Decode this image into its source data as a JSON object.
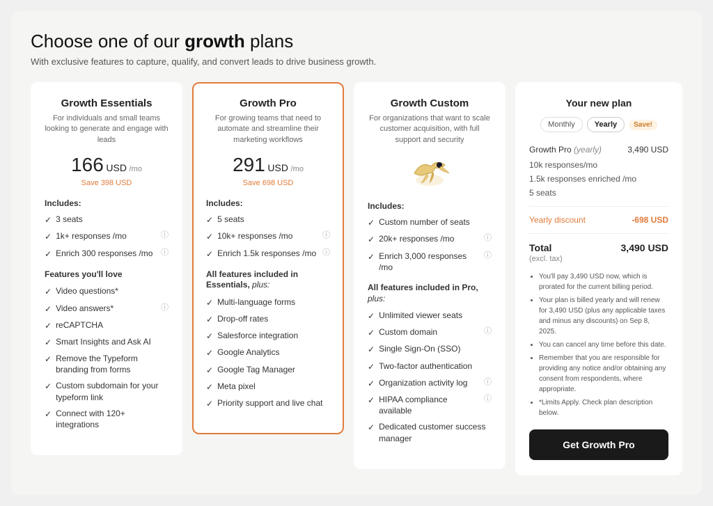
{
  "page": {
    "heading_plain": "Choose one of our ",
    "heading_bold": "growth",
    "heading_end": " plans",
    "subtitle": "With exclusive features to capture, qualify, and convert leads to drive business growth."
  },
  "plans": [
    {
      "id": "essentials",
      "title": "Growth Essentials",
      "desc": "For individuals and small teams looking to generate and engage with leads",
      "price_amount": "166",
      "price_currency": "USD",
      "price_per": "/mo",
      "savings": "Save 398 USD",
      "includes_label": "Includes:",
      "base_features": [
        {
          "text": "3 seats",
          "info": false
        },
        {
          "text": "1k+ responses /mo",
          "info": true
        },
        {
          "text": "Enrich 300 responses /mo",
          "info": true
        }
      ],
      "love_label": "Features you'll love",
      "love_features": [
        {
          "text": "Video questions*",
          "info": false
        },
        {
          "text": "Video answers*",
          "info": true
        },
        {
          "text": "reCAPTCHA",
          "info": false
        },
        {
          "text": "Smart Insights and Ask AI",
          "info": false
        },
        {
          "text": "Remove the Typeform branding from forms",
          "info": false
        },
        {
          "text": "Custom subdomain for your typeform link",
          "info": false
        },
        {
          "text": "Connect with 120+ integrations",
          "info": false
        }
      ],
      "highlighted": false
    },
    {
      "id": "pro",
      "title": "Growth Pro",
      "desc": "For growing teams that need to automate and streamline their marketing workflows",
      "price_amount": "291",
      "price_currency": "USD",
      "price_per": "/mo",
      "savings": "Save 698 USD",
      "includes_label": "Includes:",
      "base_features": [
        {
          "text": "5 seats",
          "info": false
        },
        {
          "text": "10k+ responses /mo",
          "info": true
        },
        {
          "text": "Enrich 1.5k responses /mo",
          "info": true
        }
      ],
      "section_label": "All features included in Essentials, plus:",
      "love_features": [
        {
          "text": "Multi-language forms",
          "info": false
        },
        {
          "text": "Drop-off rates",
          "info": false
        },
        {
          "text": "Salesforce integration",
          "info": false
        },
        {
          "text": "Google Analytics",
          "info": false
        },
        {
          "text": "Google Tag Manager",
          "info": false
        },
        {
          "text": "Meta pixel",
          "info": false
        },
        {
          "text": "Priority support and live chat",
          "info": false
        }
      ],
      "highlighted": true
    },
    {
      "id": "custom",
      "title": "Growth Custom",
      "desc": "For organizations that want to scale customer acquisition, with full support and security",
      "icon": "🦅",
      "includes_label": "Includes:",
      "base_features": [
        {
          "text": "Custom number of seats",
          "info": false
        },
        {
          "text": "20k+ responses /mo",
          "info": true
        },
        {
          "text": "Enrich 3,000 responses /mo",
          "info": true
        }
      ],
      "section_label": "All features included in Pro, plus:",
      "love_features": [
        {
          "text": "Unlimited viewer seats",
          "info": false
        },
        {
          "text": "Custom domain",
          "info": true
        },
        {
          "text": "Single Sign-On (SSO)",
          "info": false
        },
        {
          "text": "Two-factor authentication",
          "info": false
        },
        {
          "text": "Organization activity log",
          "info": true
        },
        {
          "text": "HIPAA compliance available",
          "info": true
        },
        {
          "text": "Dedicated customer success manager",
          "info": false
        }
      ],
      "highlighted": false
    }
  ],
  "sidebar": {
    "title": "Your new plan",
    "billing_options": [
      "Monthly",
      "Yearly"
    ],
    "active_billing": "Yearly",
    "save_badge": "Save!",
    "plan_name": "Growth Pro",
    "plan_billing_note": "yearly",
    "plan_price": "3,490 USD",
    "features": [
      "10k responses/mo",
      "1.5k responses enriched /mo",
      "5 seats"
    ],
    "yearly_discount_label": "Yearly discount",
    "yearly_discount_value": "-698 USD",
    "total_label": "Total",
    "total_value": "3,490 USD",
    "total_note": "(excl. tax)",
    "notes": [
      "You'll pay 3,490 USD now, which is prorated for the current billing period.",
      "Your plan is billed yearly and will renew for 3,490 USD (plus any applicable taxes and minus any discounts) on Sep 8, 2025.",
      "You can cancel any time before this date.",
      "Remember that you are responsible for providing any notice and/or obtaining any consent from respondents, where appropriate.",
      "*Limits Apply. Check plan description below."
    ],
    "cta_label": "Get Growth Pro"
  }
}
